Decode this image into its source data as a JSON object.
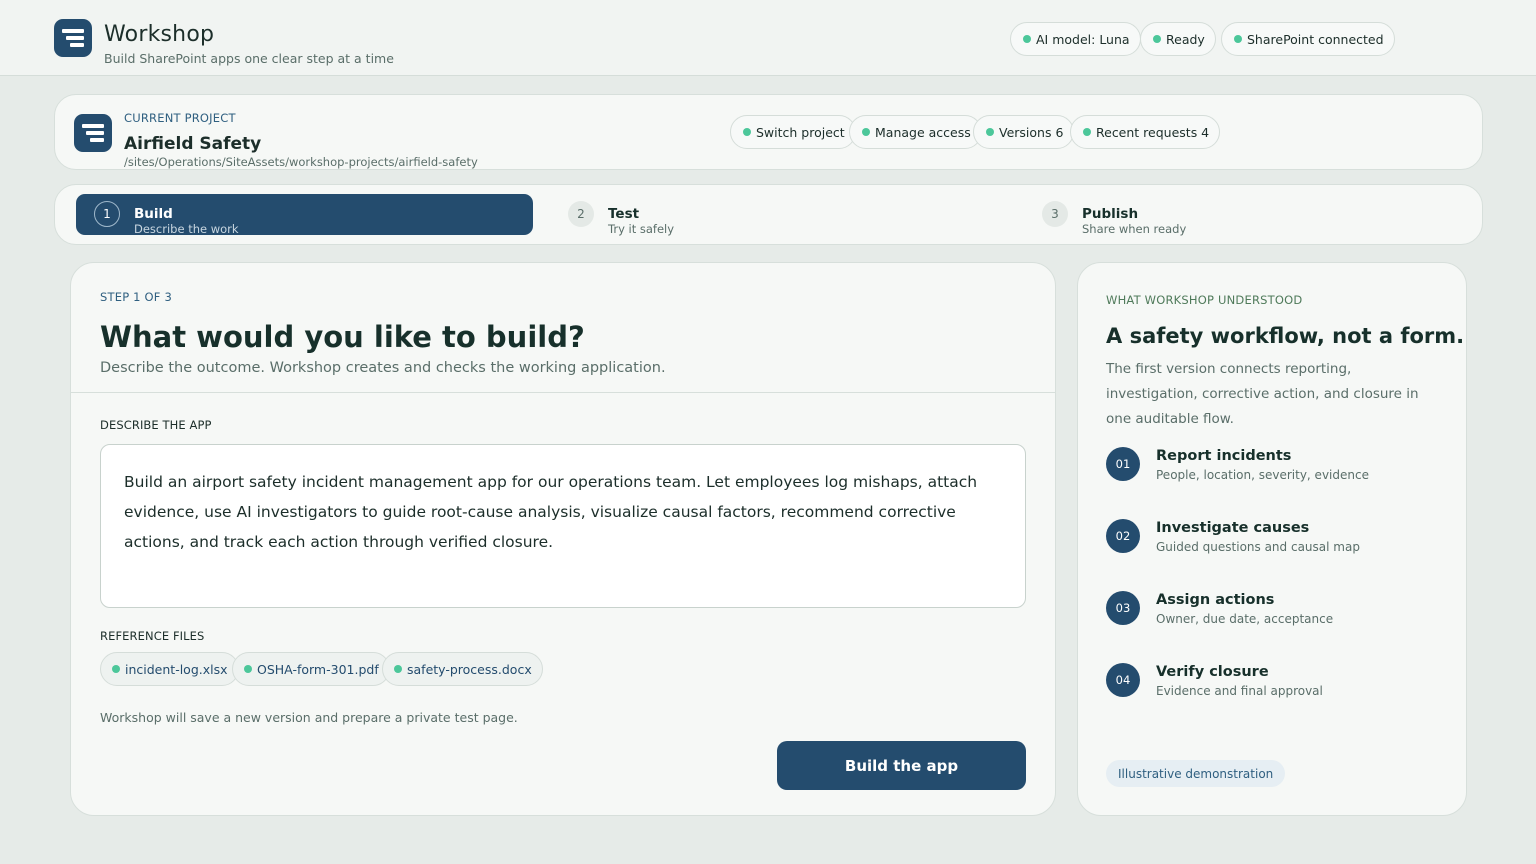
{
  "app": {
    "title": "Workshop",
    "subtitle": "Build SharePoint apps one clear step at a time",
    "logo_icon": "workshop-logo-icon",
    "accent_color": "#244c6e",
    "status_dot_color": "#4cc79a"
  },
  "status": {
    "model": "AI model: Luna",
    "ready": "Ready",
    "sharepoint": "SharePoint connected"
  },
  "project": {
    "label": "CURRENT PROJECT",
    "name": "Airfield Safety",
    "path": "/sites/Operations/SiteAssets/workshop-projects/airfield-safety",
    "actions": {
      "switch": "Switch project",
      "access": "Manage access",
      "versions": "Versions 6",
      "requests": "Recent requests 4"
    }
  },
  "steps": [
    {
      "num": "1",
      "title": "Build",
      "sub": "Describe the work",
      "active": true
    },
    {
      "num": "2",
      "title": "Test",
      "sub": "Try it safely",
      "active": false
    },
    {
      "num": "3",
      "title": "Publish",
      "sub": "Share when ready",
      "active": false
    }
  ],
  "main": {
    "eyebrow": "STEP 1 OF 3",
    "title": "What would you like to build?",
    "lead": "Describe the outcome. Workshop creates and checks the working application.",
    "describe_label": "DESCRIBE THE APP",
    "description": "Build an airport safety incident management app for our operations team. Let employees log mishaps, attach evidence, use AI investigators to guide root-cause analysis, visualize causal factors, recommend corrective actions, and track each action through verified closure.",
    "files_label": "REFERENCE FILES",
    "files": [
      "incident-log.xlsx",
      "OSHA-form-301.pdf",
      "safety-process.docx"
    ],
    "note": "Workshop will save a new version and prepare a private test page.",
    "build_button": "Build the app"
  },
  "side": {
    "eyebrow": "WHAT WORKSHOP UNDERSTOOD",
    "title": "A safety workflow, not a form.",
    "lead": "The first version connects reporting, investigation, corrective action, and closure in one auditable flow.",
    "items": [
      {
        "num": "01",
        "title": "Report incidents",
        "sub": "People, location, severity, evidence"
      },
      {
        "num": "02",
        "title": "Investigate causes",
        "sub": "Guided questions and causal map"
      },
      {
        "num": "03",
        "title": "Assign actions",
        "sub": "Owner, due date, acceptance"
      },
      {
        "num": "04",
        "title": "Verify closure",
        "sub": "Evidence and final approval"
      }
    ],
    "tag": "Illustrative demonstration"
  }
}
